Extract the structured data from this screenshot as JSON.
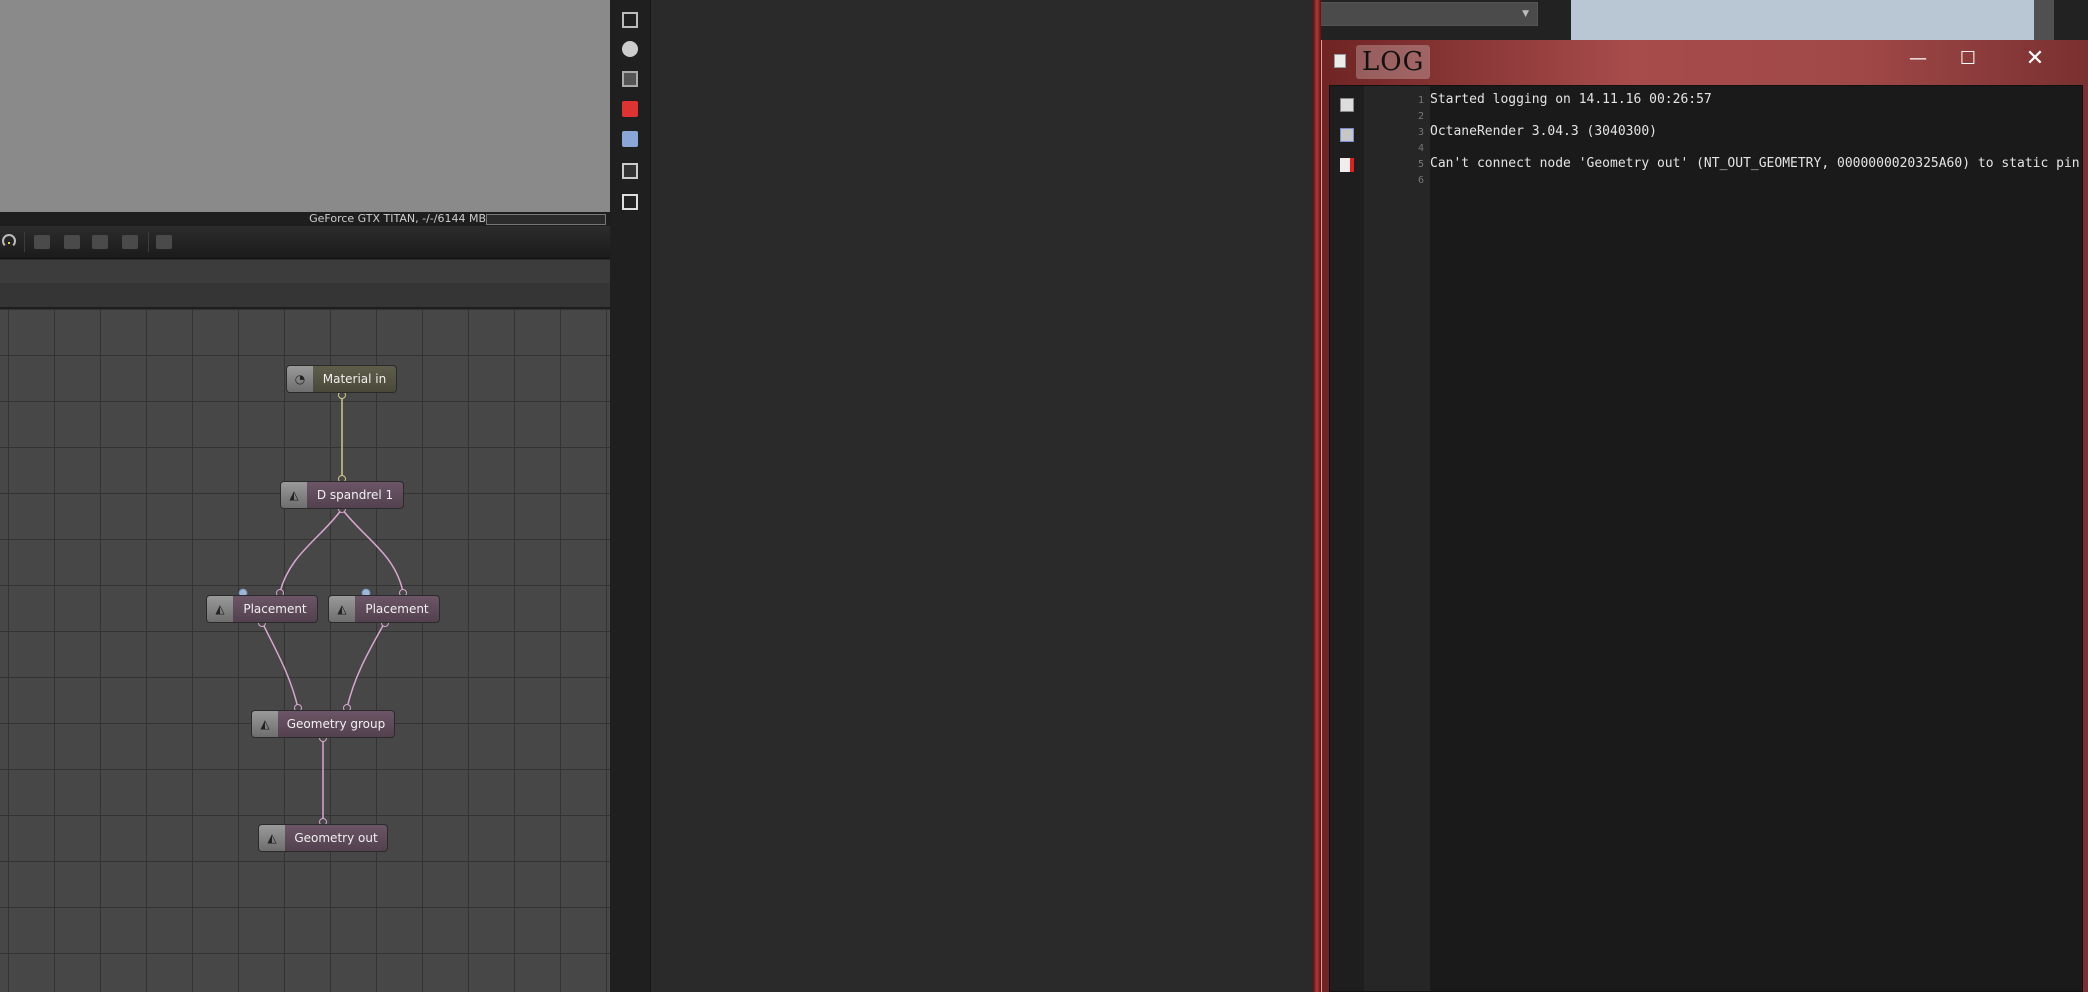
{
  "render_viewport": {
    "gpu_status": "GeForce GTX TITAN, -/-/6144 MB"
  },
  "node_graph": {
    "nodes": {
      "material_in": {
        "label": "Material in",
        "icon": "texture-node-icon"
      },
      "displacement": {
        "label": "D spandrel 1",
        "icon": "geometry-node-icon"
      },
      "placement_left": {
        "label": "Placement",
        "icon": "geometry-node-icon"
      },
      "placement_right": {
        "label": "Placement",
        "icon": "geometry-node-icon"
      },
      "geometry_group": {
        "label": "Geometry group",
        "icon": "geometry-node-icon"
      },
      "geometry_out": {
        "label": "Geometry out",
        "icon": "geometry-node-icon"
      }
    },
    "wire_colors": {
      "texture": "#cfc98a",
      "geometry": "#d8a6d0"
    }
  },
  "log_window": {
    "title": "LOG",
    "buttons": {
      "minimize": "—",
      "maximize": "☐",
      "close": "✕"
    },
    "lines": [
      {
        "number": "1",
        "text": "Started logging on 14.11.16 00:26:57"
      },
      {
        "number": "2",
        "text": ""
      },
      {
        "number": "3",
        "text": "OctaneRender 3.04.3 (3040300)"
      },
      {
        "number": "4",
        "text": ""
      },
      {
        "number": "5",
        "text": "Can't connect node 'Geometry out' (NT_OUT_GEOMETRY, 0000000020325A60) to static pin 'g"
      },
      {
        "number": "6",
        "text": ""
      }
    ]
  },
  "colors": {
    "log_frame_red": "#a74b4b",
    "texture_node": "#5f5d4a",
    "geometry_node": "#6b5566"
  }
}
